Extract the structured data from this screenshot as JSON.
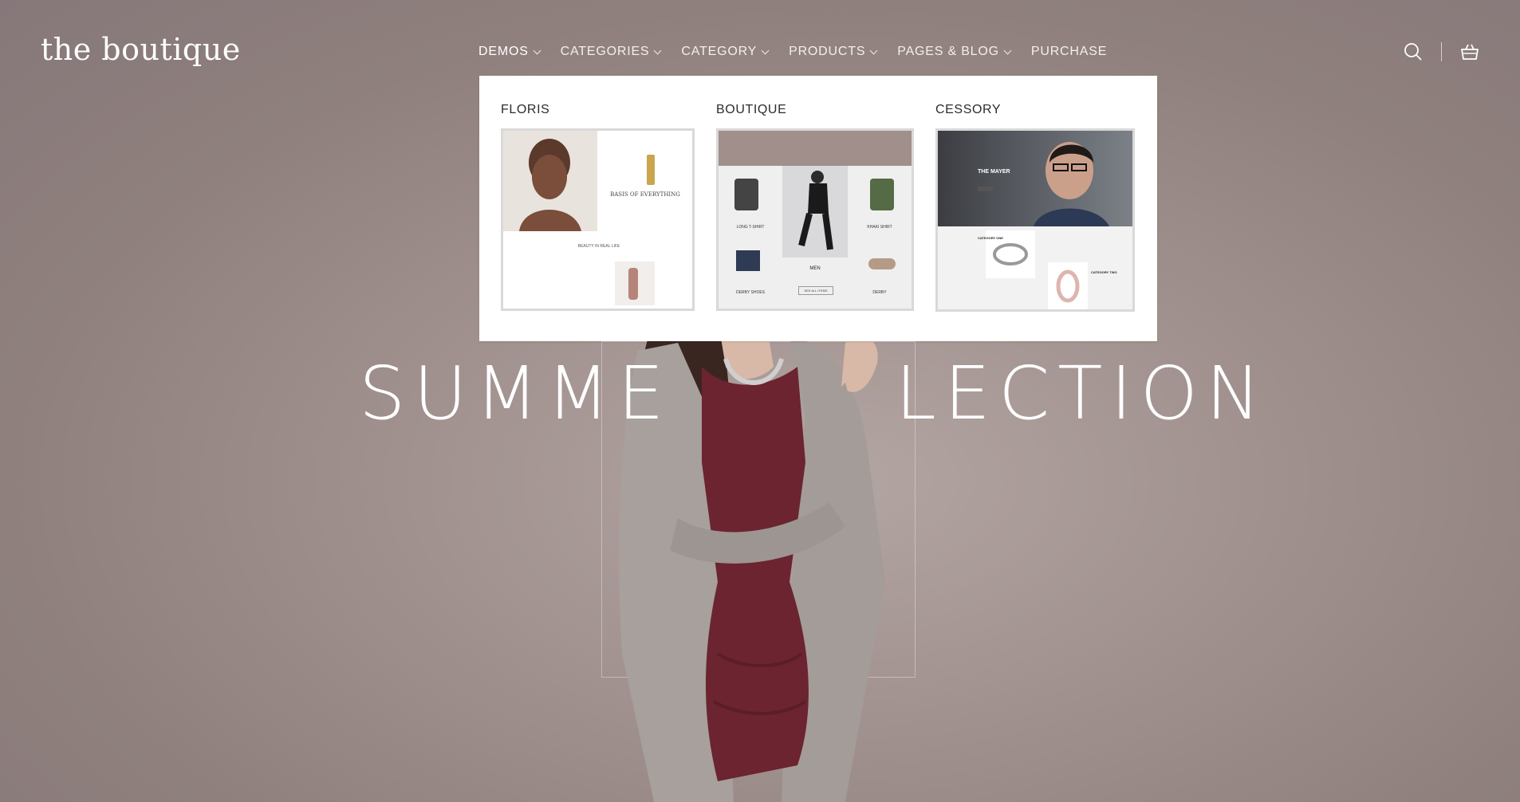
{
  "header": {
    "logo": "the boutique",
    "nav": [
      {
        "label": "DEMOS"
      },
      {
        "label": "CATEGORIES"
      },
      {
        "label": "CATEGORY"
      },
      {
        "label": "PRODUCTS"
      },
      {
        "label": "PAGES & BLOG"
      },
      {
        "label": "PURCHASE"
      }
    ]
  },
  "mega_menu": {
    "demos": [
      {
        "title": "FLORIS",
        "thumb_heading": "BASIS OF EVERYTHING",
        "thumb_caption": "BEAUTY IN REAL LIFE"
      },
      {
        "title": "BOUTIQUE",
        "thumb_left_top": "LONG T-SHIRT",
        "thumb_right_top": "KHAKI SHIRT",
        "thumb_center": "MEN",
        "thumb_button": "SEE ALL ITEMS",
        "thumb_left_bottom": "DERBY SHOES",
        "thumb_right_bottom": "DERBY"
      },
      {
        "title": "CESSORY",
        "thumb_heading": "THE MAYER",
        "thumb_cat_one": "CATEGORY ONE",
        "thumb_cat_two": "CATEGORY TWO"
      }
    ]
  },
  "hero": {
    "left_text": "SUMME",
    "right_text": "LECTION"
  },
  "colors": {
    "background": "#8e7f7c",
    "dress": "#6b2430",
    "cardigan": "#a39b97"
  }
}
